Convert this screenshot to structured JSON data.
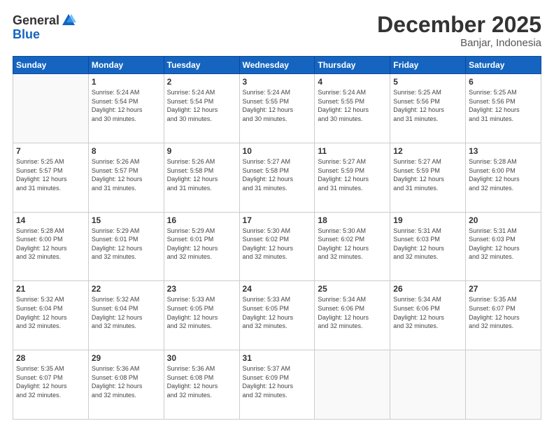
{
  "header": {
    "logo_general": "General",
    "logo_blue": "Blue",
    "title": "December 2025",
    "subtitle": "Banjar, Indonesia"
  },
  "calendar": {
    "days_of_week": [
      "Sunday",
      "Monday",
      "Tuesday",
      "Wednesday",
      "Thursday",
      "Friday",
      "Saturday"
    ],
    "weeks": [
      [
        {
          "day": "",
          "info": ""
        },
        {
          "day": "1",
          "info": "Sunrise: 5:24 AM\nSunset: 5:54 PM\nDaylight: 12 hours\nand 30 minutes."
        },
        {
          "day": "2",
          "info": "Sunrise: 5:24 AM\nSunset: 5:54 PM\nDaylight: 12 hours\nand 30 minutes."
        },
        {
          "day": "3",
          "info": "Sunrise: 5:24 AM\nSunset: 5:55 PM\nDaylight: 12 hours\nand 30 minutes."
        },
        {
          "day": "4",
          "info": "Sunrise: 5:24 AM\nSunset: 5:55 PM\nDaylight: 12 hours\nand 30 minutes."
        },
        {
          "day": "5",
          "info": "Sunrise: 5:25 AM\nSunset: 5:56 PM\nDaylight: 12 hours\nand 31 minutes."
        },
        {
          "day": "6",
          "info": "Sunrise: 5:25 AM\nSunset: 5:56 PM\nDaylight: 12 hours\nand 31 minutes."
        }
      ],
      [
        {
          "day": "7",
          "info": "Sunrise: 5:25 AM\nSunset: 5:57 PM\nDaylight: 12 hours\nand 31 minutes."
        },
        {
          "day": "8",
          "info": "Sunrise: 5:26 AM\nSunset: 5:57 PM\nDaylight: 12 hours\nand 31 minutes."
        },
        {
          "day": "9",
          "info": "Sunrise: 5:26 AM\nSunset: 5:58 PM\nDaylight: 12 hours\nand 31 minutes."
        },
        {
          "day": "10",
          "info": "Sunrise: 5:27 AM\nSunset: 5:58 PM\nDaylight: 12 hours\nand 31 minutes."
        },
        {
          "day": "11",
          "info": "Sunrise: 5:27 AM\nSunset: 5:59 PM\nDaylight: 12 hours\nand 31 minutes."
        },
        {
          "day": "12",
          "info": "Sunrise: 5:27 AM\nSunset: 5:59 PM\nDaylight: 12 hours\nand 31 minutes."
        },
        {
          "day": "13",
          "info": "Sunrise: 5:28 AM\nSunset: 6:00 PM\nDaylight: 12 hours\nand 32 minutes."
        }
      ],
      [
        {
          "day": "14",
          "info": "Sunrise: 5:28 AM\nSunset: 6:00 PM\nDaylight: 12 hours\nand 32 minutes."
        },
        {
          "day": "15",
          "info": "Sunrise: 5:29 AM\nSunset: 6:01 PM\nDaylight: 12 hours\nand 32 minutes."
        },
        {
          "day": "16",
          "info": "Sunrise: 5:29 AM\nSunset: 6:01 PM\nDaylight: 12 hours\nand 32 minutes."
        },
        {
          "day": "17",
          "info": "Sunrise: 5:30 AM\nSunset: 6:02 PM\nDaylight: 12 hours\nand 32 minutes."
        },
        {
          "day": "18",
          "info": "Sunrise: 5:30 AM\nSunset: 6:02 PM\nDaylight: 12 hours\nand 32 minutes."
        },
        {
          "day": "19",
          "info": "Sunrise: 5:31 AM\nSunset: 6:03 PM\nDaylight: 12 hours\nand 32 minutes."
        },
        {
          "day": "20",
          "info": "Sunrise: 5:31 AM\nSunset: 6:03 PM\nDaylight: 12 hours\nand 32 minutes."
        }
      ],
      [
        {
          "day": "21",
          "info": "Sunrise: 5:32 AM\nSunset: 6:04 PM\nDaylight: 12 hours\nand 32 minutes."
        },
        {
          "day": "22",
          "info": "Sunrise: 5:32 AM\nSunset: 6:04 PM\nDaylight: 12 hours\nand 32 minutes."
        },
        {
          "day": "23",
          "info": "Sunrise: 5:33 AM\nSunset: 6:05 PM\nDaylight: 12 hours\nand 32 minutes."
        },
        {
          "day": "24",
          "info": "Sunrise: 5:33 AM\nSunset: 6:05 PM\nDaylight: 12 hours\nand 32 minutes."
        },
        {
          "day": "25",
          "info": "Sunrise: 5:34 AM\nSunset: 6:06 PM\nDaylight: 12 hours\nand 32 minutes."
        },
        {
          "day": "26",
          "info": "Sunrise: 5:34 AM\nSunset: 6:06 PM\nDaylight: 12 hours\nand 32 minutes."
        },
        {
          "day": "27",
          "info": "Sunrise: 5:35 AM\nSunset: 6:07 PM\nDaylight: 12 hours\nand 32 minutes."
        }
      ],
      [
        {
          "day": "28",
          "info": "Sunrise: 5:35 AM\nSunset: 6:07 PM\nDaylight: 12 hours\nand 32 minutes."
        },
        {
          "day": "29",
          "info": "Sunrise: 5:36 AM\nSunset: 6:08 PM\nDaylight: 12 hours\nand 32 minutes."
        },
        {
          "day": "30",
          "info": "Sunrise: 5:36 AM\nSunset: 6:08 PM\nDaylight: 12 hours\nand 32 minutes."
        },
        {
          "day": "31",
          "info": "Sunrise: 5:37 AM\nSunset: 6:09 PM\nDaylight: 12 hours\nand 32 minutes."
        },
        {
          "day": "",
          "info": ""
        },
        {
          "day": "",
          "info": ""
        },
        {
          "day": "",
          "info": ""
        }
      ]
    ]
  }
}
